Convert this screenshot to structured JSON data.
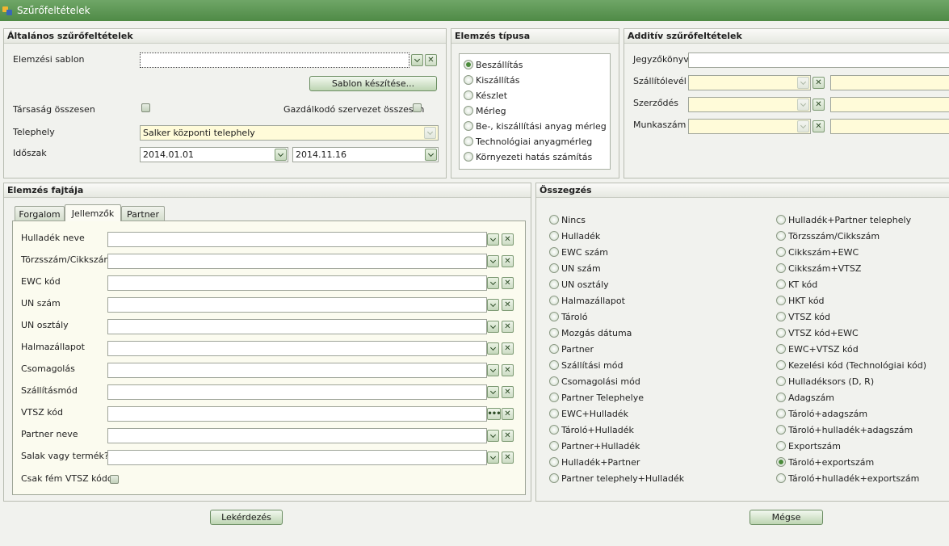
{
  "window": {
    "title": "Szűrőfeltételek"
  },
  "general": {
    "title": "Általános szűrőfeltételek",
    "template_label": "Elemzési sablon",
    "template_value": "",
    "create_template_button": "Sablon készítése...",
    "company_total_label": "Társaság összesen",
    "economic_org_total_label": "Gazdálkodó szervezet összesen",
    "site_label": "Telephely",
    "site_value": "Salker központi telephely",
    "period_label": "Időszak",
    "period_from": "2014.01.01",
    "period_to": "2014.11.16"
  },
  "analysis_type": {
    "title": "Elemzés típusa",
    "options": [
      {
        "label": "Beszállítás",
        "checked": true
      },
      {
        "label": "Kiszállítás",
        "checked": false
      },
      {
        "label": "Készlet",
        "checked": false
      },
      {
        "label": "Mérleg",
        "checked": false
      },
      {
        "label": "Be-, kiszállítási anyag mérleg",
        "checked": false
      },
      {
        "label": "Technológiai anyagmérleg",
        "checked": false
      },
      {
        "label": "Környezeti hatás számítás",
        "checked": false
      }
    ]
  },
  "additive": {
    "title": "Additív szűrőfeltételek",
    "report_label": "Jegyzőkönyv",
    "delivery_note_label": "Szállítólevél",
    "contract_label": "Szerződés",
    "job_number_label": "Munkaszám"
  },
  "analysis_kind": {
    "title": "Elemzés fajtája",
    "tabs": [
      "Forgalom",
      "Jellemzők",
      "Partner"
    ],
    "fields": [
      {
        "label": "Hulladék neve",
        "button": "dropdown"
      },
      {
        "label": "Törzsszám/Cikkszám",
        "button": "dropdown"
      },
      {
        "label": "EWC kód",
        "button": "dropdown"
      },
      {
        "label": "UN szám",
        "button": "dropdown"
      },
      {
        "label": "UN osztály",
        "button": "dropdown"
      },
      {
        "label": "Halmazállapot",
        "button": "dropdown"
      },
      {
        "label": "Csomagolás",
        "button": "dropdown"
      },
      {
        "label": "Szállításmód",
        "button": "dropdown"
      },
      {
        "label": "VTSZ kód",
        "button": "dots"
      },
      {
        "label": "Partner neve",
        "button": "dropdown"
      },
      {
        "label": "Salak vagy termék?",
        "button": "dropdown"
      }
    ],
    "metal_only_label": "Csak fém VTSZ kódok"
  },
  "summary": {
    "title": "Összegzés",
    "left": [
      {
        "label": "Nincs",
        "checked": false
      },
      {
        "label": "Hulladék",
        "checked": false
      },
      {
        "label": "EWC szám",
        "checked": false
      },
      {
        "label": "UN szám",
        "checked": false
      },
      {
        "label": "UN osztály",
        "checked": false
      },
      {
        "label": "Halmazállapot",
        "checked": false
      },
      {
        "label": "Tároló",
        "checked": false
      },
      {
        "label": "Mozgás dátuma",
        "checked": false
      },
      {
        "label": "Partner",
        "checked": false
      },
      {
        "label": "Szállítási mód",
        "checked": false
      },
      {
        "label": "Csomagolási mód",
        "checked": false
      },
      {
        "label": "Partner Telephelye",
        "checked": false
      },
      {
        "label": "EWC+Hulladék",
        "checked": false
      },
      {
        "label": "Tároló+Hulladék",
        "checked": false
      },
      {
        "label": "Partner+Hulladék",
        "checked": false
      },
      {
        "label": "Hulladék+Partner",
        "checked": false
      },
      {
        "label": "Partner telephely+Hulladék",
        "checked": false
      }
    ],
    "right": [
      {
        "label": "Hulladék+Partner telephely",
        "checked": false
      },
      {
        "label": "Törzsszám/Cikkszám",
        "checked": false
      },
      {
        "label": "Cikkszám+EWC",
        "checked": false
      },
      {
        "label": "Cikkszám+VTSZ",
        "checked": false
      },
      {
        "label": "KT kód",
        "checked": false
      },
      {
        "label": "HKT kód",
        "checked": false
      },
      {
        "label": "VTSZ kód",
        "checked": false
      },
      {
        "label": "VTSZ kód+EWC",
        "checked": false
      },
      {
        "label": "EWC+VTSZ kód",
        "checked": false
      },
      {
        "label": "Kezelési kód (Technológiai kód)",
        "checked": false
      },
      {
        "label": "Hulladéksors (D, R)",
        "checked": false
      },
      {
        "label": "Adagszám",
        "checked": false
      },
      {
        "label": "Tároló+adagszám",
        "checked": false
      },
      {
        "label": "Tároló+hulladék+adagszám",
        "checked": false
      },
      {
        "label": "Exportszám",
        "checked": false
      },
      {
        "label": "Tároló+exportszám",
        "checked": true
      },
      {
        "label": "Tároló+hulladék+exportszám",
        "checked": false
      }
    ]
  },
  "actions": {
    "query_button": "Lekérdezés",
    "cancel_button": "Mégse"
  },
  "colors": {
    "titlebar": "#5a9651",
    "field_yellow": "#fffbd9",
    "accent_green": "#4a8a3a"
  }
}
